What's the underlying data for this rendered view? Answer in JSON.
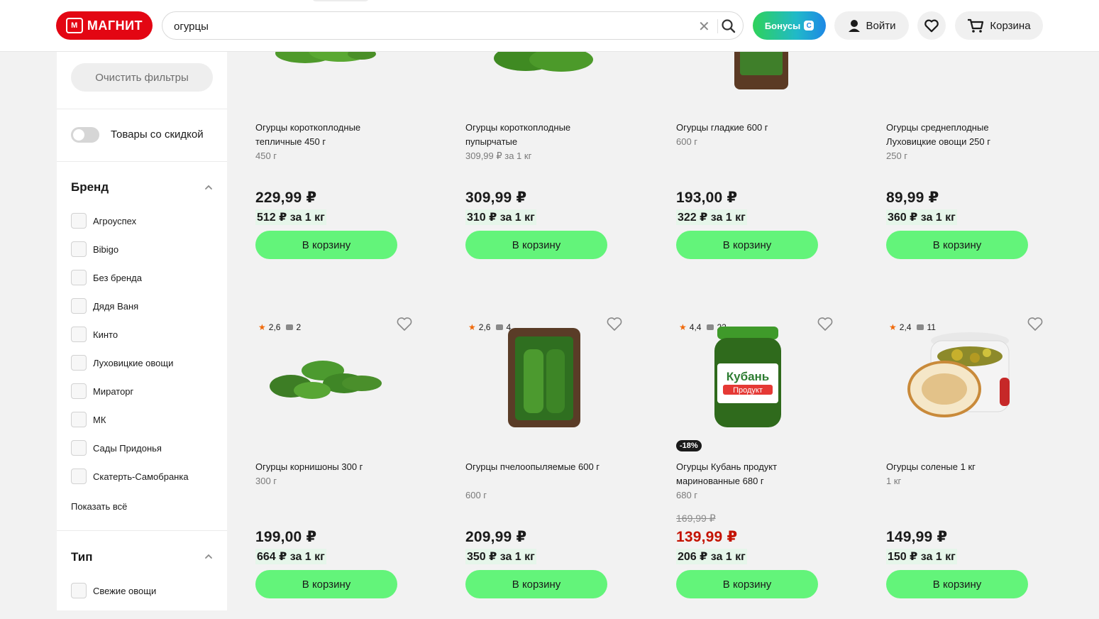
{
  "header": {
    "logo_text": "МАГНИТ",
    "search_value": "огурцы",
    "bonus_label": "Бонусы",
    "login_label": "Войти",
    "cart_label": "Корзина",
    "colors": {
      "brand": "#e30613",
      "button_green": "#63f47a",
      "sale_red": "#c41200"
    }
  },
  "sidebar": {
    "clear_filters": "Очистить фильтры",
    "discount_toggle_label": "Товары со скидкой",
    "brand_title": "Бренд",
    "brands": [
      "Агроуспех",
      "Bibigo",
      "Без бренда",
      "Дядя Ваня",
      "Кинто",
      "Луховицкие овощи",
      "Мираторг",
      "МК",
      "Сады Придонья",
      "Скатерть-Самобранка"
    ],
    "show_all": "Показать всё",
    "type_title": "Тип",
    "types": [
      "Свежие овощи"
    ]
  },
  "products": [
    {
      "title": "Огурцы короткоплодные тепличные 450 г",
      "weight": "450 г",
      "price": "229,99 ₽",
      "unit_price": "512 ₽ за 1 кг",
      "button": "В корзину"
    },
    {
      "title": "Огурцы короткоплодные пупырчатые",
      "weight": "309,99 ₽ за 1 кг",
      "price": "309,99 ₽",
      "unit_price": "310 ₽ за 1 кг",
      "button": "В корзину"
    },
    {
      "title": "Огурцы гладкие 600 г",
      "weight": "600 г",
      "price": "193,00 ₽",
      "unit_price": "322 ₽ за 1 кг",
      "button": "В корзину"
    },
    {
      "title": "Огурцы среднеплодные Луховицкие овощи 250 г",
      "weight": "250 г",
      "price": "89,99 ₽",
      "unit_price": "360 ₽ за 1 кг",
      "button": "В корзину"
    },
    {
      "rating": "2,6",
      "reviews": "2",
      "title": "Огурцы корнишоны 300 г",
      "weight": "300 г",
      "price": "199,00 ₽",
      "unit_price": "664 ₽ за 1 кг",
      "button": "В корзину"
    },
    {
      "rating": "2,6",
      "reviews": "4",
      "title": "Огурцы пчелоопыляемые 600 г",
      "weight": "600 г",
      "price": "209,99 ₽",
      "unit_price": "350 ₽ за 1 кг",
      "button": "В корзину"
    },
    {
      "rating": "4,4",
      "reviews": "22",
      "discount": "-18%",
      "title": "Огурцы Кубань продукт маринованные 680 г",
      "weight": "680 г",
      "old_price": "169,99 ₽",
      "price": "139,99 ₽",
      "unit_price": "206 ₽ за 1 кг",
      "button": "В корзину",
      "jar_label_1": "Кубань",
      "jar_label_2": "Продукт"
    },
    {
      "rating": "2,4",
      "reviews": "11",
      "title": "Огурцы соленые 1 кг",
      "weight": "1 кг",
      "price": "149,99 ₽",
      "unit_price": "150 ₽ за 1 кг",
      "button": "В корзину"
    }
  ]
}
